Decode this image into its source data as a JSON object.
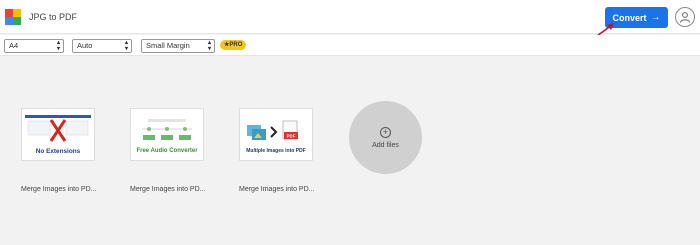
{
  "app": {
    "title": "JPG to PDF"
  },
  "header": {
    "convert_label": "Convert",
    "convert_arrow": "→"
  },
  "colors": {
    "accent": "#1a73e8",
    "pro": "#f5c518",
    "logo": [
      "#e94335",
      "#fbbc05",
      "#4285f4",
      "#34a853"
    ]
  },
  "toolbar": {
    "page_size": "A4",
    "orientation": "Auto",
    "margin": "Small Margin",
    "pro_badge": "★PRO"
  },
  "files": [
    {
      "name": "Merge Images into PD...",
      "thumb_text": "No Extensions"
    },
    {
      "name": "Merge Images into PD...",
      "thumb_text": "Free Audio Converter"
    },
    {
      "name": "Merge Images into PD...",
      "thumb_text": "Multiple Images into PDF",
      "thumb_badge": "PDF"
    }
  ],
  "add_files": {
    "label": "Add files",
    "icon": "plus-circle-icon"
  }
}
